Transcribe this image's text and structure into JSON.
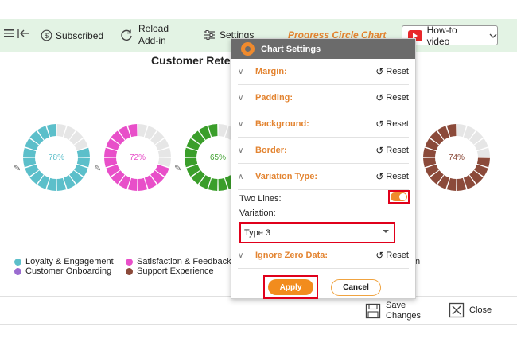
{
  "toolbar": {
    "subscribed_label": "Subscribed",
    "reload_label_1": "Reload",
    "reload_label_2": "Add-in",
    "settings_label": "Settings",
    "chart_name": "Progress Circle Chart",
    "howto_label": "How-to video"
  },
  "chart": {
    "title": "Customer Rete",
    "ring_color": "#e6e6e6"
  },
  "chart_data": {
    "type": "progress-circle",
    "title": "Customer Rete",
    "items": [
      {
        "label": "78%",
        "value": 78,
        "color": "#5cbfca"
      },
      {
        "label": "72%",
        "value": 72,
        "color": "#e84fc9"
      },
      {
        "label": "65%",
        "value": 65,
        "color": "#3a9e2a"
      },
      {
        "label": "74%",
        "value": 74,
        "color": "#8b4a3a"
      }
    ],
    "legend": [
      {
        "name": "Loyalty & Engagement",
        "color": "#5cbfca"
      },
      {
        "name": "Customer Onboarding",
        "color": "#9b6cd0"
      },
      {
        "name": "Satisfaction & Feedback",
        "color": "#e84fc9"
      },
      {
        "name": "Support Experience",
        "color": "#8b4a3a"
      }
    ],
    "legend_partial_text": "n"
  },
  "dialog": {
    "title": "Chart Settings",
    "sections": [
      "Margin:",
      "Padding:",
      "Background:",
      "Border:",
      "Variation Type:"
    ],
    "reset_label": "Reset",
    "two_lines_label": "Two Lines:",
    "variation_label": "Variation:",
    "variation_value": "Type 3",
    "ignore_zero_label": "Ignore Zero Data:",
    "apply_label": "Apply",
    "cancel_label": "Cancel",
    "two_lines_on": true,
    "accent_color": "#e38431"
  },
  "footer": {
    "save_label_1": "Save",
    "save_label_2": "Changes",
    "close_label": "Close"
  }
}
